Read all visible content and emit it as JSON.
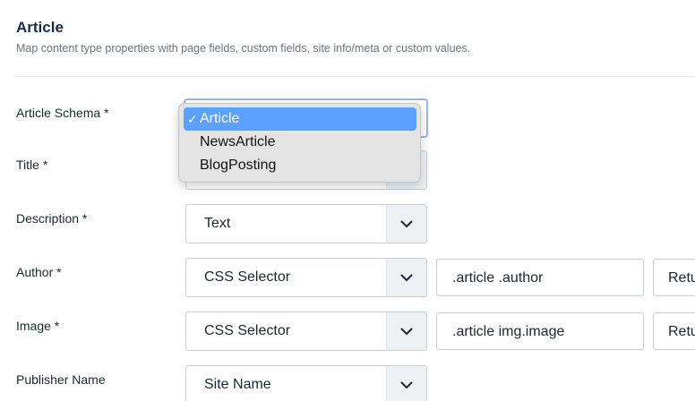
{
  "section": {
    "title": "Article",
    "description": "Map content type properties with page fields, custom fields, site info/meta or custom values."
  },
  "fields": {
    "article_schema": {
      "label": "Article Schema *",
      "value": "Article"
    },
    "title": {
      "label": "Title *"
    },
    "description": {
      "label": "Description *",
      "value": "Text"
    },
    "author": {
      "label": "Author *",
      "source": "CSS Selector",
      "selector": ".article .author",
      "extra": "Retu"
    },
    "image": {
      "label": "Image *",
      "source": "CSS Selector",
      "selector": ".article img.image",
      "extra": "Retu"
    },
    "publisher_name": {
      "label": "Publisher Name",
      "source": "Site Name"
    }
  },
  "dropdown": {
    "check": "✓",
    "options": [
      "Article",
      "NewsArticle",
      "BlogPosting"
    ],
    "selected": "Article"
  },
  "icons": {
    "select_arrow": "chevron-down-icon"
  },
  "colors": {
    "dropdown_highlight": "#5aa0ff",
    "focus_ring": "#9ab8e6",
    "title": "#1a2b4a"
  }
}
